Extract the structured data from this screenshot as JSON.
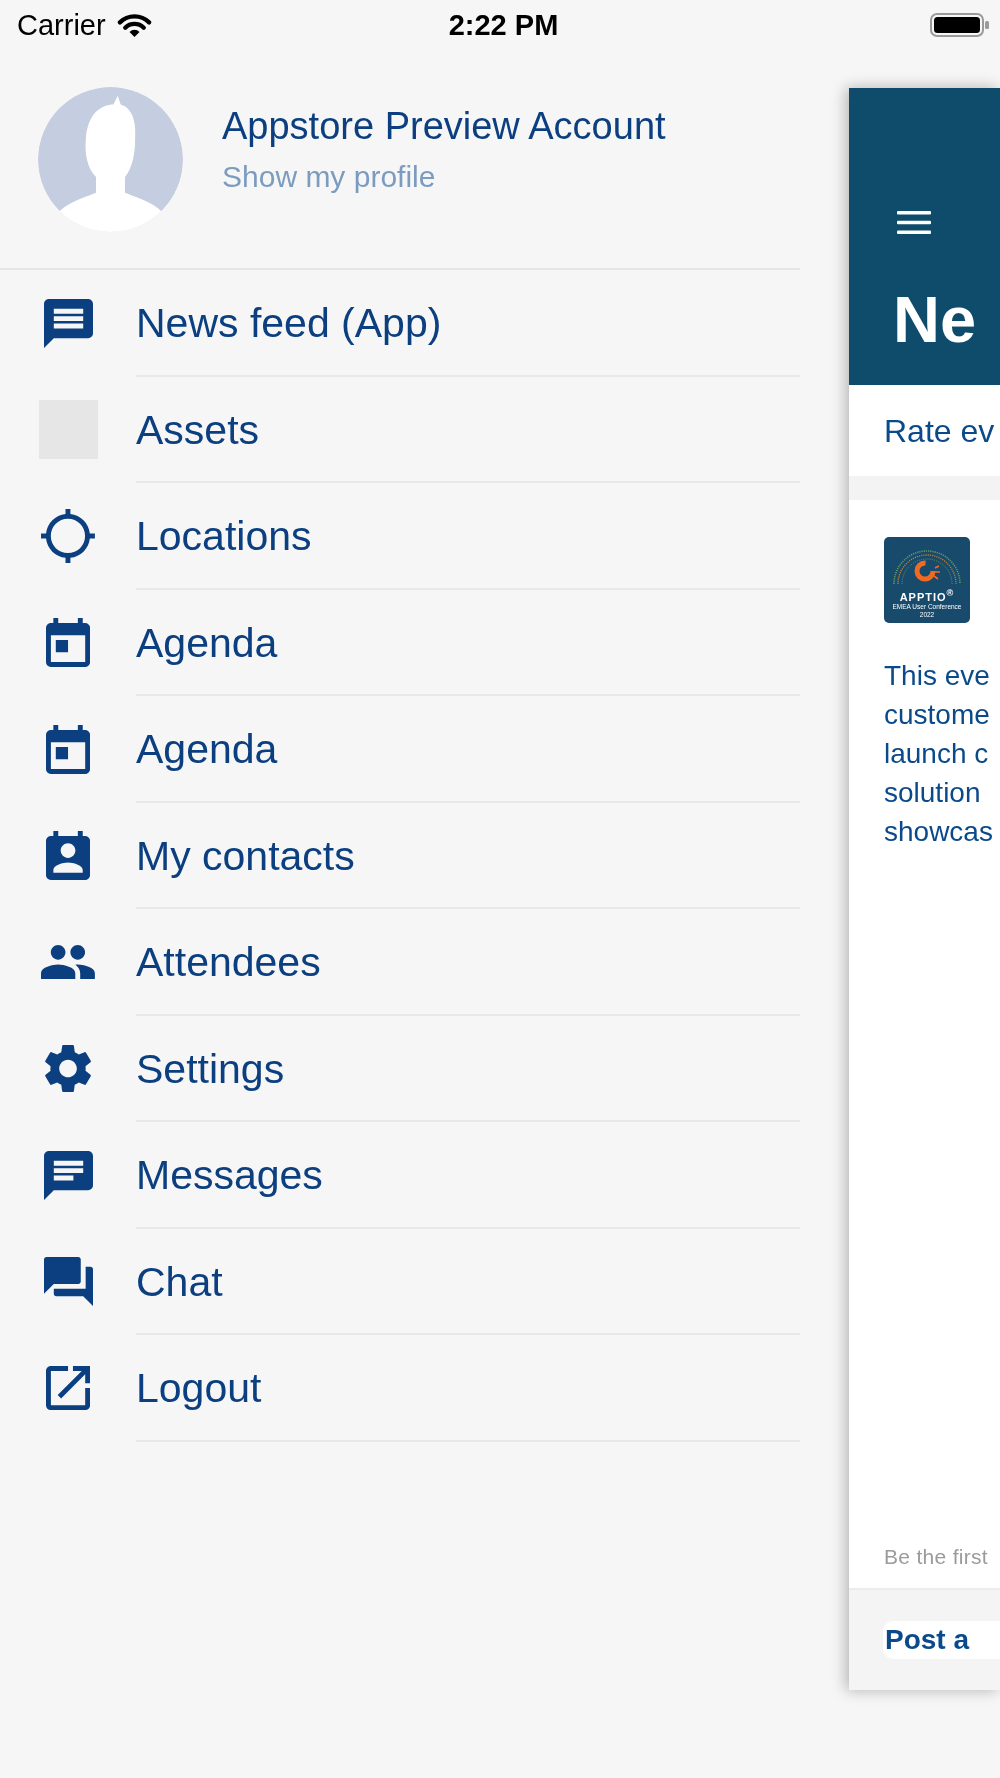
{
  "status_bar": {
    "carrier": "Carrier",
    "time": "2:22 PM"
  },
  "profile": {
    "name": "Appstore Preview Account",
    "link": "Show my profile"
  },
  "menu": {
    "items": [
      {
        "label": "News feed (App)"
      },
      {
        "label": "Assets"
      },
      {
        "label": "Locations"
      },
      {
        "label": "Agenda"
      },
      {
        "label": "Agenda"
      },
      {
        "label": "My contacts"
      },
      {
        "label": "Attendees"
      },
      {
        "label": "Settings"
      },
      {
        "label": "Messages"
      },
      {
        "label": "Chat"
      },
      {
        "label": "Logout"
      }
    ]
  },
  "screen": {
    "title": "Ne",
    "rate_link": "Rate ev",
    "logo": {
      "wordmark": "APPTIO$^{®}$",
      "caption": "EMEA User Conference",
      "year": "2022"
    },
    "body_lines": [
      "This eve",
      "custome",
      "launch c",
      "solution",
      "showcas"
    ],
    "hint": "Be the first",
    "post_button": "Post a"
  }
}
